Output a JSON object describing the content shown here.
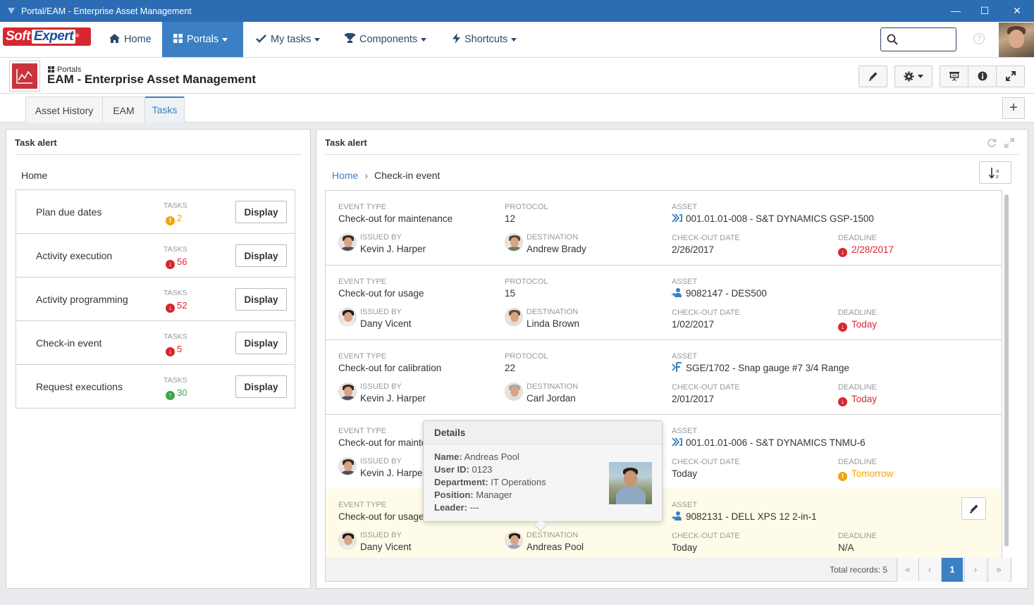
{
  "window": {
    "title": "Portal/EAM - Enterprise Asset Management"
  },
  "logo": {
    "soft": "Soft",
    "expert": "Expert",
    "reg": "®"
  },
  "nav": {
    "home": "Home",
    "portals": "Portals",
    "my_tasks": "My tasks",
    "components": "Components",
    "shortcuts": "Shortcuts",
    "search_value": "",
    "help": "?"
  },
  "header": {
    "breadcrumb": "Portals",
    "title": "EAM - Enterprise Asset Management"
  },
  "tabs": [
    {
      "label": "Asset History"
    },
    {
      "label": "EAM"
    },
    {
      "label": "Tasks"
    }
  ],
  "add_tab": "+",
  "left_panel": {
    "title": "Task alert",
    "home": "Home",
    "tasks_label": "TASKS",
    "display_label": "Display",
    "items": [
      {
        "name": "Plan due dates",
        "count": "2",
        "status": "warning",
        "color": "#f0a30a",
        "glyph": "!"
      },
      {
        "name": "Activity execution",
        "count": "56",
        "status": "overdue",
        "color": "#d8262f",
        "glyph": "↓"
      },
      {
        "name": "Activity programming",
        "count": "52",
        "status": "overdue",
        "color": "#d8262f",
        "glyph": "↓"
      },
      {
        "name": "Check-in event",
        "count": "5",
        "status": "overdue",
        "color": "#d8262f",
        "glyph": "↓"
      },
      {
        "name": "Request executions",
        "count": "30",
        "status": "ok",
        "color": "#3aa64b",
        "glyph": "↑"
      }
    ]
  },
  "right_panel": {
    "title": "Task alert",
    "breadcrumb": {
      "home": "Home",
      "sep": "›",
      "current": "Check-in event"
    },
    "labels": {
      "event_type": "EVENT TYPE",
      "protocol": "PROTOCOL",
      "asset": "ASSET",
      "issued_by": "ISSUED BY",
      "destination": "DESTINATION",
      "checkout_date": "CHECK-OUT DATE",
      "deadline": "DEADLINE"
    },
    "events": [
      {
        "event_type": "Check-out for maintenance",
        "protocol": "12",
        "asset": "001.01.01-008 - S&T DYNAMICS GSP-1500",
        "asset_icon": "maintenance-icon",
        "issued_by": "Kevin J. Harper",
        "destination": "Andrew Brady",
        "checkout_date": "2/26/2017",
        "deadline": "2/28/2017",
        "deadline_status": "overdue",
        "deadline_glyph": "↓"
      },
      {
        "event_type": "Check-out for usage",
        "protocol": "15",
        "asset": "9082147 - DES500",
        "asset_icon": "usage-icon",
        "issued_by": "Dany Vicent",
        "destination": "Linda Brown",
        "checkout_date": "1/02/2017",
        "deadline": "Today",
        "deadline_status": "overdue",
        "deadline_glyph": "↓"
      },
      {
        "event_type": "Check-out for calibration",
        "protocol": "22",
        "asset": "SGE/1702 - Snap gauge #7 3/4 Range",
        "asset_icon": "calibration-icon",
        "issued_by": "Kevin J. Harper",
        "destination": "Carl Jordan",
        "checkout_date": "2/01/2017",
        "deadline": "Today",
        "deadline_status": "overdue",
        "deadline_glyph": "↓"
      },
      {
        "event_type": "Check-out for maintenance",
        "protocol": "",
        "asset": "001.01.01-006 - S&T DYNAMICS TNMU-6",
        "asset_icon": "maintenance-icon",
        "issued_by": "Kevin J. Harper",
        "destination": "",
        "checkout_date": "Today",
        "deadline": "Tomorrow",
        "deadline_status": "warning",
        "deadline_glyph": "!"
      },
      {
        "event_type": "Check-out for usage",
        "protocol": "",
        "asset": "9082131 - DELL XPS 12 2-in-1",
        "asset_icon": "usage-icon",
        "issued_by": "Dany Vicent",
        "destination": "Andreas Pool",
        "checkout_date": "Today",
        "deadline": "N/A",
        "deadline_status": "none",
        "deadline_glyph": ""
      }
    ],
    "pager": {
      "total": "Total records: 5",
      "first": "«",
      "prev": "‹",
      "page": "1",
      "next": "›",
      "last": "»"
    }
  },
  "tooltip": {
    "title": "Details",
    "name_label": "Name:",
    "name": "Andreas Pool",
    "user_id_label": "User ID:",
    "user_id": "0123",
    "department_label": "Department:",
    "department": "IT Operations",
    "position_label": "Position:",
    "position": "Manager",
    "leader_label": "Leader:",
    "leader": "---"
  },
  "colors": {
    "accent": "#3b7fc4",
    "titlebar": "#2b6cb3",
    "overdue": "#d8262f",
    "warning": "#f0a30a",
    "ok": "#3aa64b",
    "selected_row": "#fefce9"
  }
}
